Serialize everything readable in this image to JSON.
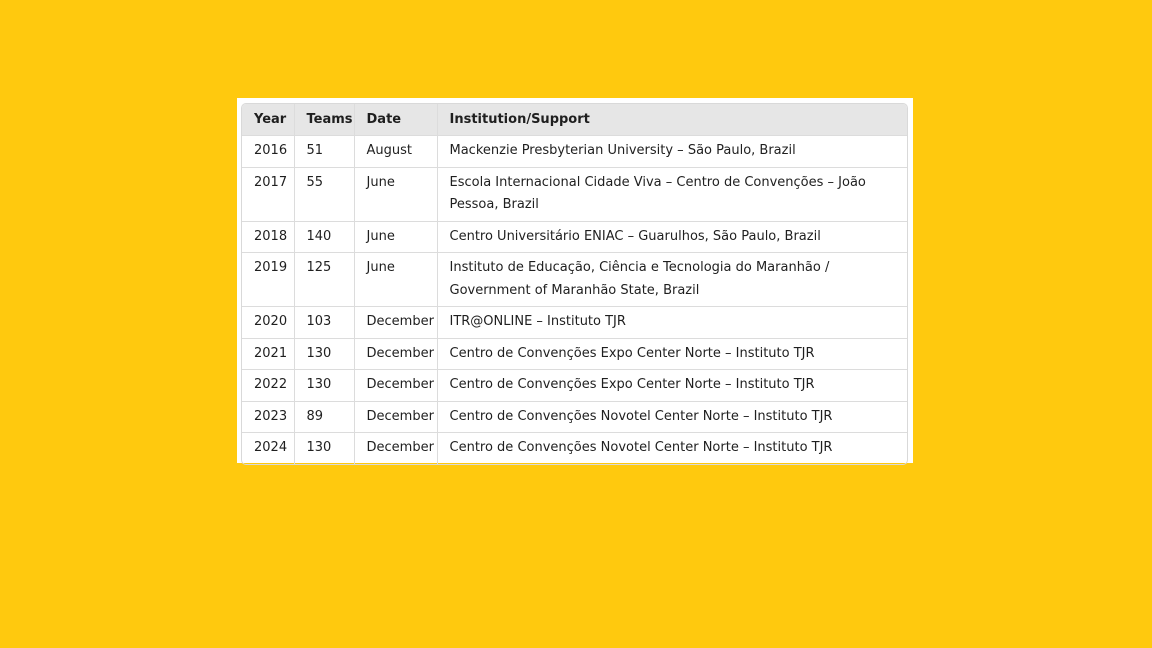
{
  "table": {
    "headers": [
      "Year",
      "Teams",
      "Date",
      "Institution/Support"
    ],
    "rows": [
      [
        "2016",
        "51",
        "August",
        "Mackenzie Presbyterian University – São Paulo, Brazil"
      ],
      [
        "2017",
        "55",
        "June",
        "Escola Internacional Cidade Viva – Centro de Convenções – João Pessoa, Brazil"
      ],
      [
        "2018",
        "140",
        "June",
        "Centro Universitário ENIAC – Guarulhos, São Paulo, Brazil"
      ],
      [
        "2019",
        "125",
        "June",
        "Instituto de Educação, Ciência e Tecnologia do Maranhão / Government of Maranhão State, Brazil"
      ],
      [
        "2020",
        "103",
        "December",
        "ITR@ONLINE – Instituto TJR"
      ],
      [
        "2021",
        "130",
        "December",
        "Centro de Convenções Expo Center Norte – Instituto TJR"
      ],
      [
        "2022",
        "130",
        "December",
        "Centro de Convenções Expo Center Norte – Instituto TJR"
      ],
      [
        "2023",
        "89",
        "December",
        "Centro de Convenções Novotel Center Norte – Instituto TJR"
      ],
      [
        "2024",
        "130",
        "December",
        "Centro de Convenções Novotel Center Norte – Instituto TJR"
      ]
    ]
  },
  "colors": {
    "background": "#FFC90E",
    "header_bg": "#E6E6E6",
    "border": "#DCDCDC"
  }
}
